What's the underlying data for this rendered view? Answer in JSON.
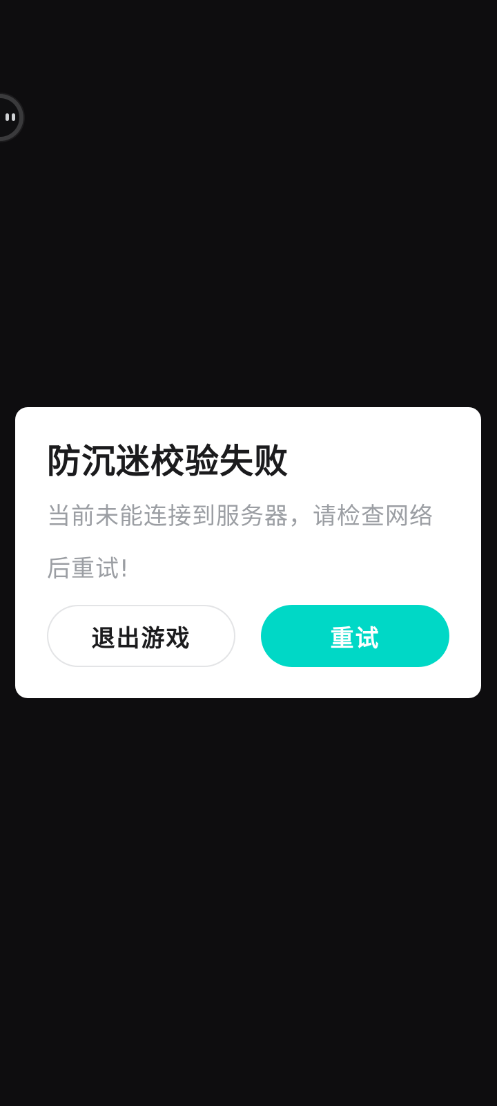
{
  "dialog": {
    "title": "防沉迷校验失败",
    "message": "当前未能连接到服务器，请检查网络后重试!",
    "exit_label": "退出游戏",
    "retry_label": "重试"
  },
  "colors": {
    "background": "#0e0d0f",
    "dialog_bg": "#ffffff",
    "title": "#1b1b1d",
    "message": "#9b9ea3",
    "accent": "#00d8c6"
  },
  "icons": {
    "floating_ball": "assistant-face-icon"
  }
}
